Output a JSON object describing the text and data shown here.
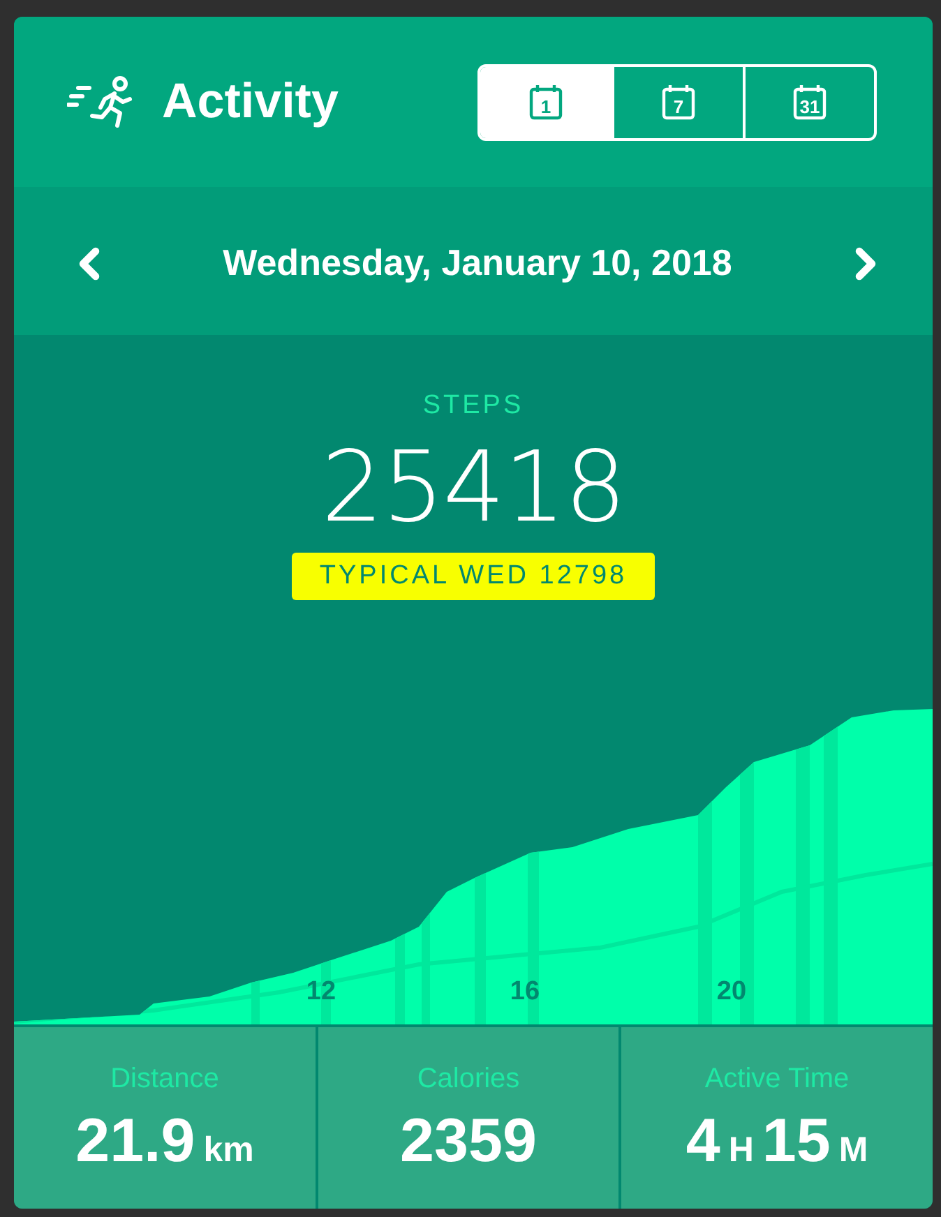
{
  "header": {
    "title": "Activity",
    "ranges": [
      {
        "label": "1",
        "selected": true
      },
      {
        "label": "7",
        "selected": false
      },
      {
        "label": "31",
        "selected": false
      }
    ]
  },
  "date_bar": {
    "date": "Wednesday, January 10, 2018"
  },
  "steps": {
    "label": "STEPS",
    "value": "25418",
    "typical": "TYPICAL WED 12798"
  },
  "chart": {
    "hour_labels": [
      "12",
      "16",
      "20"
    ]
  },
  "stats": [
    {
      "label": "Distance",
      "value": [
        {
          "text": "21.9",
          "kind": "number"
        },
        {
          "text": "km",
          "kind": "unit"
        }
      ]
    },
    {
      "label": "Calories",
      "value": [
        {
          "text": "2359",
          "kind": "number"
        }
      ]
    },
    {
      "label": "Active Time",
      "value": [
        {
          "text": "4",
          "kind": "number"
        },
        {
          "text": "H",
          "kind": "unit"
        },
        {
          "text": "15",
          "kind": "number"
        },
        {
          "text": "M",
          "kind": "unit"
        }
      ]
    }
  ]
}
